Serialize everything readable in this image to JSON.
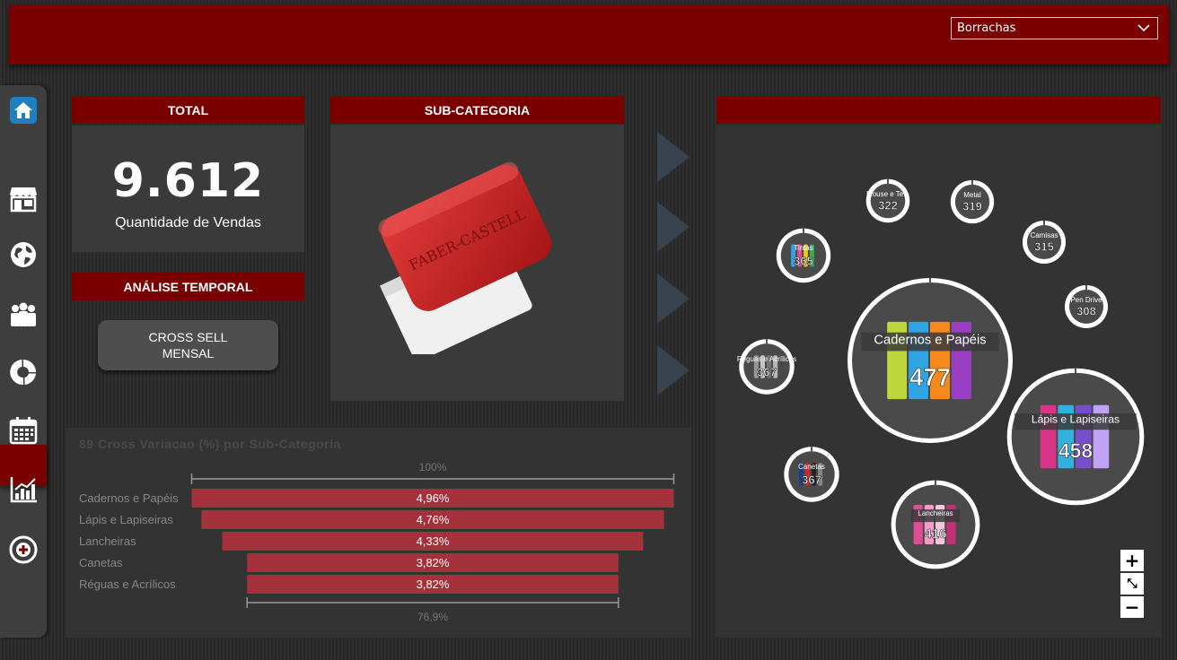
{
  "header": {
    "dropdown_value": "Borrachas"
  },
  "total": {
    "header": "TOTAL",
    "value": "9.612",
    "caption": "Quantidade de Vendas"
  },
  "temporal": {
    "header": "ANÁLISE TEMPORAL"
  },
  "cross_sell_button": {
    "line1": "CROSS SELL",
    "line2": "MENSAL"
  },
  "subcategory": {
    "header": "SUB-CATEGORIA",
    "image_alt": "Faber-Castell eraser",
    "logo_text": "FABER-CASTELL"
  },
  "bubble_panel": {
    "header": ""
  },
  "colors": {
    "brand_red": "#7a0000",
    "bar_red": "#a4323d",
    "panel": "#3a3a3a",
    "sidebar": "#3e3e3e"
  },
  "sidebar": {
    "items": [
      {
        "icon": "home-icon"
      },
      {
        "icon": "store-icon"
      },
      {
        "icon": "globe-icon"
      },
      {
        "icon": "people-icon"
      },
      {
        "icon": "donut-chart-icon"
      },
      {
        "icon": "calendar-icon"
      },
      {
        "icon": "bar-chart-icon"
      },
      {
        "icon": "cross-sell-icon",
        "active": true
      }
    ]
  },
  "chart_data": [
    {
      "type": "bar",
      "title": "89 Cross Variacao (%) por Sub-Categoria",
      "categories": [
        "Cadernos e Papéis",
        "Lápis e Lapiseiras",
        "Lancheiras",
        "Canetas",
        "Réguas e Acrílicos"
      ],
      "values": [
        4.96,
        4.76,
        4.33,
        3.82,
        3.82
      ],
      "labels": [
        "4,96%",
        "4,76%",
        "4,33%",
        "3,82%",
        "3,82%"
      ],
      "top_scale_label": "100%",
      "bottom_scale_label": "76,9%",
      "color": "#a4323d"
    },
    {
      "type": "scatter",
      "subtype": "bubble",
      "items": [
        {
          "name": "Cadernos e Papéis",
          "value": 477
        },
        {
          "name": "Lápis e Lapiseiras",
          "value": 458
        },
        {
          "name": "Lancheiras",
          "value": 416
        },
        {
          "name": "Canetas",
          "value": 367
        },
        {
          "name": "Réguas e Acrílicos",
          "value": 367
        },
        {
          "name": "Tintas",
          "value": 365
        },
        {
          "name": "Mouse e Te...",
          "value": 322
        },
        {
          "name": "Metal",
          "value": 319
        },
        {
          "name": "Camisas",
          "value": 315
        },
        {
          "name": "Pen Drive",
          "value": 308
        }
      ]
    }
  ],
  "zoom": {
    "plus": "+",
    "minus": "−",
    "fit": "⤡"
  }
}
